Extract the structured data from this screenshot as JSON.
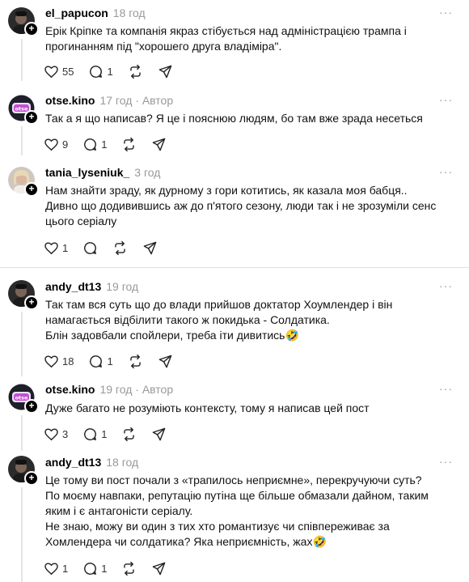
{
  "posts": [
    {
      "user": "el_papucon",
      "time": "18 год",
      "author_tag": "",
      "lines": [
        "Ерік Кріпке та компанія якраз стібується над адміністрацією трампа і",
        "прогинанням під \"хорошего друга владіміра\"."
      ],
      "likes": "55",
      "replies": "1",
      "avatar": "dark-portrait"
    },
    {
      "user": "otse.kino",
      "time": "17 год",
      "author_tag": "· Автор",
      "lines": [
        "Так а я що написав? Я це і пояснюю людям, бо там вже зрада несеться"
      ],
      "likes": "9",
      "replies": "1",
      "avatar": "otse-logo"
    },
    {
      "user": "tania_lyseniuk_",
      "time": "3 год",
      "author_tag": "",
      "lines": [
        "Нам знайти зраду, як дурному з гори котитись, як казала моя бабця..",
        "Дивно що додивившись аж до п'ятого сезону, люди так і не зрозуміли сенс",
        "цього серіалу"
      ],
      "likes": "1",
      "replies": "",
      "avatar": "blonde-portrait"
    },
    {
      "user": "andy_dt13",
      "time": "19 год",
      "author_tag": "",
      "lines": [
        "Так там вся суть що до влади прийшов доктатор Хоумлендер і він",
        "намагається відбілити такого ж покидька - Солдатика.",
        "Блін задовбали спойлери, треба іти дивитись🤣"
      ],
      "likes": "18",
      "replies": "1",
      "avatar": "dark-portrait"
    },
    {
      "user": "otse.kino",
      "time": "19 год",
      "author_tag": "· Автор",
      "lines": [
        "Дуже багато не розуміють контексту, тому я написав цей пост"
      ],
      "likes": "3",
      "replies": "1",
      "avatar": "otse-logo"
    },
    {
      "user": "andy_dt13",
      "time": "18 год",
      "author_tag": "",
      "lines": [
        "Це тому ви пост почали з «трапилось неприємне», перекручуючи суть?",
        "По моєму навпаки, репутацію путіна ще більше обмазали дайном, таким",
        "яким і є антагоністи серіалу.",
        "Не знаю, можу ви один з тих хто романтизує чи співпереживає за",
        "Хомлендера чи солдатика? Яка неприємність, жах🤣"
      ],
      "likes": "1",
      "replies": "1",
      "avatar": "dark-portrait"
    }
  ],
  "more_label": "···",
  "plus_label": "+",
  "logo_text": "otse"
}
